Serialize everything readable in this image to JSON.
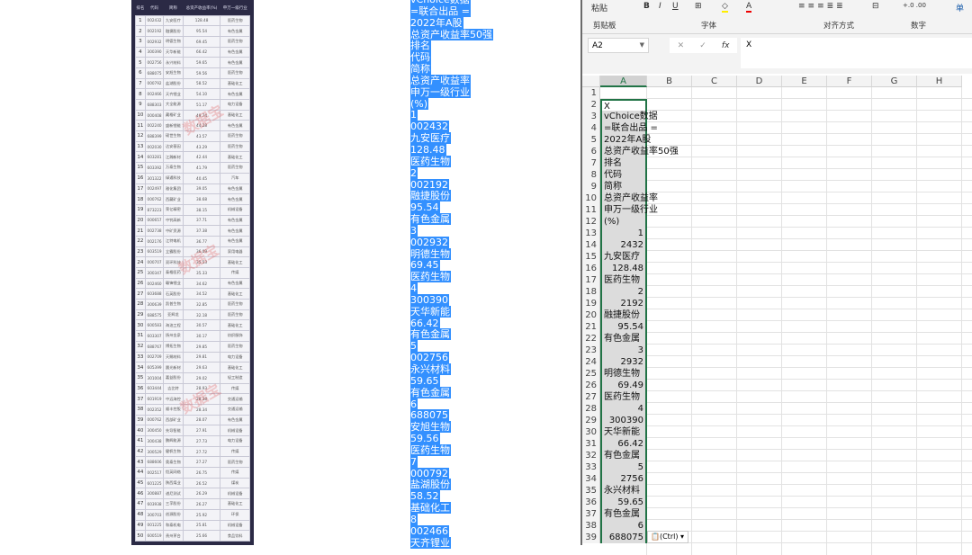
{
  "table": {
    "headers": [
      "排名",
      "代码",
      "简称",
      "总资产收益率(%)",
      "申万一级行业"
    ],
    "watermark": "数据宝",
    "rows": [
      [
        "1",
        "002432",
        "九安医疗",
        "128.48",
        "医药生物"
      ],
      [
        "2",
        "002192",
        "融捷股份",
        "95.54",
        "有色金属"
      ],
      [
        "3",
        "002932",
        "明德生物",
        "69.45",
        "医药生物"
      ],
      [
        "4",
        "300390",
        "天华新能",
        "66.42",
        "有色金属"
      ],
      [
        "5",
        "002756",
        "永兴材料",
        "59.65",
        "有色金属"
      ],
      [
        "6",
        "688075",
        "安旭生物",
        "59.56",
        "医药生物"
      ],
      [
        "7",
        "000792",
        "盐湖股份",
        "58.52",
        "基础化工"
      ],
      [
        "8",
        "002466",
        "天齐锂业",
        "54.10",
        "有色金属"
      ],
      [
        "9",
        "688303",
        "大全能源",
        "51.17",
        "电力设备"
      ],
      [
        "10",
        "000408",
        "藏格矿业",
        "49.74",
        "基础化工"
      ],
      [
        "11",
        "002240",
        "盛新锂能",
        "44.28",
        "有色金属"
      ],
      [
        "12",
        "688399",
        "硕世生物",
        "43.57",
        "医药生物"
      ],
      [
        "13",
        "002030",
        "达安基因",
        "43.29",
        "医药生物"
      ],
      [
        "14",
        "603281",
        "江瀚新材",
        "42.44",
        "基础化工"
      ],
      [
        "15",
        "603392",
        "万泰生物",
        "41.79",
        "医药生物"
      ],
      [
        "16",
        "301322",
        "绿通科技",
        "40.45",
        "汽车"
      ],
      [
        "17",
        "002497",
        "雅化集团",
        "39.05",
        "有色金属"
      ],
      [
        "18",
        "000762",
        "西藏矿业",
        "38.68",
        "有色金属"
      ],
      [
        "19",
        "873223",
        "荣亿精密",
        "38.15",
        "机械设备"
      ],
      [
        "20",
        "000657",
        "中钨高新",
        "37.71",
        "有色金属"
      ],
      [
        "21",
        "002738",
        "中矿资源",
        "37.38",
        "有色金属"
      ],
      [
        "22",
        "002176",
        "江特电机",
        "36.77",
        "有色金属"
      ],
      [
        "23",
        "603519",
        "立霸股份",
        "36.09",
        "家用电器"
      ],
      [
        "24",
        "000707",
        "双环科技",
        "35.53",
        "基础化工"
      ],
      [
        "25",
        "300347",
        "泰格医药",
        "35.33",
        "传媒"
      ],
      [
        "26",
        "002460",
        "赣锋锂业",
        "34.62",
        "有色金属"
      ],
      [
        "27",
        "603688",
        "石英股份",
        "34.52",
        "基础化工"
      ],
      [
        "28",
        "300639",
        "凯普生物",
        "32.85",
        "医药生物"
      ],
      [
        "29",
        "688575",
        "亚辉龙",
        "32.18",
        "医药生物"
      ],
      [
        "30",
        "600583",
        "海油工程",
        "30.57",
        "基础化工"
      ],
      [
        "31",
        "603307",
        "扬州金泉",
        "30.17",
        "纺织服饰"
      ],
      [
        "32",
        "688767",
        "博拓生物",
        "29.85",
        "医药生物"
      ],
      [
        "33",
        "002709",
        "天赐材料",
        "29.81",
        "电力设备"
      ],
      [
        "34",
        "605399",
        "晨光新材",
        "29.63",
        "基础化工"
      ],
      [
        "35",
        "301004",
        "嘉益股份",
        "29.02",
        "轻工制造"
      ],
      [
        "36",
        "603444",
        "吉比特",
        "28.93",
        "传媒"
      ],
      [
        "37",
        "601919",
        "中远海控",
        "28.38",
        "交通运输"
      ],
      [
        "38",
        "002352",
        "顺丰控股",
        "28.34",
        "交通运输"
      ],
      [
        "39",
        "000762",
        "西部矿业",
        "28.07",
        "有色金属"
      ],
      [
        "40",
        "300450",
        "先导智能",
        "27.91",
        "机械设备"
      ],
      [
        "41",
        "300438",
        "鹏辉能源",
        "27.73",
        "电力设备"
      ],
      [
        "42",
        "300529",
        "健帆生物",
        "27.72",
        "传媒"
      ],
      [
        "43",
        "688606",
        "奥泰生物",
        "27.27",
        "医药生物"
      ],
      [
        "44",
        "002517",
        "恺英网络",
        "26.75",
        "传媒"
      ],
      [
        "45",
        "601225",
        "陕西煤业",
        "26.52",
        "煤炭"
      ],
      [
        "46",
        "300887",
        "谱尼测试",
        "26.29",
        "机械设备"
      ],
      [
        "47",
        "603938",
        "三孚股份",
        "26.27",
        "基础化工"
      ],
      [
        "48",
        "300703",
        "创源股份",
        "25.92",
        "环保"
      ],
      [
        "49",
        "001225",
        "和泰机电",
        "25.81",
        "机械设备"
      ],
      [
        "50",
        "600519",
        "贵州茅台",
        "25.66",
        "食品饮料"
      ]
    ]
  },
  "selected_text": [
    "vChoice数据",
    "=联合出品 =",
    "2022年A股",
    "总资产收益率50强",
    "排名",
    "代码",
    "简称",
    "总资产收益率",
    "申万一级行业",
    "(%)",
    "1",
    "002432",
    "九安医疗",
    "128.48",
    "医药生物",
    "2",
    "002192",
    "融捷股份",
    "95.54",
    "有色金属",
    "3",
    "002932",
    "明德生物",
    "69.45",
    "医药生物",
    "4",
    "300390",
    "天华新能",
    "66.42",
    "有色金属",
    "5",
    "002756",
    "永兴材料",
    "59.65",
    "有色金属",
    "6",
    "688075",
    "安旭生物",
    "59.56",
    "医药生物",
    "7",
    "000792",
    "盐湖股份",
    "58.52",
    "基础化工",
    "8",
    "002466",
    "天齐锂业"
  ],
  "excel": {
    "ribbon": {
      "paste": "粘贴",
      "clipboard": "剪贴板",
      "font": "字体",
      "alignment": "对齐方式",
      "number": "数字",
      "bold": "B",
      "italic": "I",
      "underline": "U",
      "cell_style": "单"
    },
    "name_box": "A2",
    "formula": "X",
    "fx": "fx",
    "columns": [
      "A",
      "B",
      "C",
      "D",
      "E",
      "F",
      "G",
      "H"
    ],
    "rows": [
      [
        "1",
        ""
      ],
      [
        "2",
        "X"
      ],
      [
        "3",
        "vChoice数据"
      ],
      [
        "4",
        "=联合出品 ="
      ],
      [
        "5",
        "2022年A股"
      ],
      [
        "6",
        "总资产收益率50强"
      ],
      [
        "7",
        "排名"
      ],
      [
        "8",
        "代码"
      ],
      [
        "9",
        "简称"
      ],
      [
        "10",
        "总资产收益率"
      ],
      [
        "11",
        "申万一级行业"
      ],
      [
        "12",
        "(%)"
      ],
      [
        "13",
        "1",
        true
      ],
      [
        "14",
        "2432",
        true
      ],
      [
        "15",
        "九安医疗"
      ],
      [
        "16",
        "128.48",
        true
      ],
      [
        "17",
        "医药生物"
      ],
      [
        "18",
        "2",
        true
      ],
      [
        "19",
        "2192",
        true
      ],
      [
        "20",
        "融捷股份"
      ],
      [
        "21",
        "95.54",
        true
      ],
      [
        "22",
        "有色金属"
      ],
      [
        "23",
        "3",
        true
      ],
      [
        "24",
        "2932",
        true
      ],
      [
        "25",
        "明德生物"
      ],
      [
        "26",
        "69.49",
        true
      ],
      [
        "27",
        "医药生物"
      ],
      [
        "28",
        "4",
        true
      ],
      [
        "29",
        "300390",
        true
      ],
      [
        "30",
        "天华新能"
      ],
      [
        "31",
        "66.42",
        true
      ],
      [
        "32",
        "有色金属"
      ],
      [
        "33",
        "5",
        true
      ],
      [
        "34",
        "2756",
        true
      ],
      [
        "35",
        "永兴材料"
      ],
      [
        "36",
        "59.65",
        true
      ],
      [
        "37",
        "有色金属"
      ],
      [
        "38",
        "6",
        true
      ],
      [
        "39",
        "688075",
        true
      ]
    ],
    "paste_options": "(Ctrl)",
    "accent": "#217346"
  }
}
